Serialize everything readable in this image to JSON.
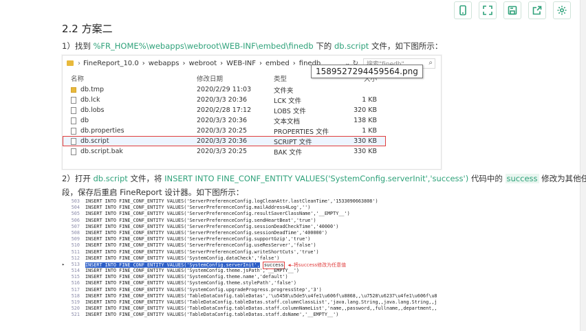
{
  "toolbar": {
    "icons": [
      "phone-icon",
      "expand-icon",
      "save-icon",
      "share-icon",
      "gear-icon"
    ]
  },
  "heading": "2.2 方案二",
  "step1": {
    "prefix": "1）找到",
    "path": "%FR_HOME%\\webapps\\webroot\\WEB-INF\\embed\\finedb",
    "mid": "下的",
    "file": "db.script",
    "suffix": "文件，如下图所示："
  },
  "explorer": {
    "breadcrumb": [
      "FineReport_10.0",
      "webapps",
      "webroot",
      "WEB-INF",
      "embed",
      "finedb"
    ],
    "search_placeholder": "搜索\"finedb\"",
    "tooltip": "1589527294459564.png",
    "columns": {
      "name": "名称",
      "date": "修改日期",
      "type": "类型",
      "size": "大小"
    },
    "rows": [
      {
        "name": "db.tmp",
        "date": "2020/2/29 11:03",
        "type": "文件夹",
        "size": "",
        "icon": "folder"
      },
      {
        "name": "db.lck",
        "date": "2020/3/3 20:36",
        "type": "LCK 文件",
        "size": "1 KB",
        "icon": "file"
      },
      {
        "name": "db.lobs",
        "date": "2020/2/28 17:12",
        "type": "LOBS 文件",
        "size": "320 KB",
        "icon": "file"
      },
      {
        "name": "db",
        "date": "2020/3/3 20:36",
        "type": "文本文档",
        "size": "138 KB",
        "icon": "file"
      },
      {
        "name": "db.properties",
        "date": "2020/3/3 20:25",
        "type": "PROPERTIES 文件",
        "size": "1 KB",
        "icon": "file"
      },
      {
        "name": "db.script",
        "date": "2020/3/3 20:36",
        "type": "SCRIPT 文件",
        "size": "330 KB",
        "icon": "file",
        "selected": true
      },
      {
        "name": "db.script.bak",
        "date": "2020/3/3 20:25",
        "type": "BAK 文件",
        "size": "330 KB",
        "icon": "file"
      }
    ]
  },
  "step2": {
    "prefix": "2）打开",
    "file": "db.script",
    "mid1": "文件，将",
    "code": "INSERT INTO FINE_CONF_ENTITY VALUES('SystemConfig.serverInit','success')",
    "mid2": "代码中的",
    "word": "success",
    "suffix": "修改为其他任意字",
    "line2": "段，保存后重启 FineReport 设计器。如下图所示："
  },
  "code": {
    "lines": [
      {
        "n": "503",
        "t": "INSERT INTO FINE_CONF_ENTITY VALUES('ServerPreferenceConfig.logCleanAttr.lastCleanTime','1533090663808')"
      },
      {
        "n": "504",
        "t": "INSERT INTO FINE_CONF_ENTITY VALUES('ServerPreferenceConfig.mailAddress4Log','')"
      },
      {
        "n": "505",
        "t": "INSERT INTO FINE_CONF_ENTITY VALUES('ServerPreferenceConfig.resultSaverClassName','__EMPTY__')"
      },
      {
        "n": "506",
        "t": "INSERT INTO FINE_CONF_ENTITY VALUES('ServerPreferenceConfig.sendHeartBeat','true')"
      },
      {
        "n": "507",
        "t": "INSERT INTO FINE_CONF_ENTITY VALUES('ServerPreferenceConfig.sessionDeadCheckTime','40000')"
      },
      {
        "n": "508",
        "t": "INSERT INTO FINE_CONF_ENTITY VALUES('ServerPreferenceConfig.sessionDeadTime','400000')"
      },
      {
        "n": "509",
        "t": "INSERT INTO FINE_CONF_ENTITY VALUES('ServerPreferenceConfig.supportGzip','true')"
      },
      {
        "n": "510",
        "t": "INSERT INTO FINE_CONF_ENTITY VALUES('ServerPreferenceConfig.useResServer','false')"
      },
      {
        "n": "511",
        "t": "INSERT INTO FINE_CONF_ENTITY VALUES('ServerPreferenceConfig.writeShortCuts','true')"
      },
      {
        "n": "512",
        "t": "INSERT INTO FINE_CONF_ENTITY VALUES('SystemConfig.dataCheck','false')"
      },
      {
        "n": "513",
        "sel": "INSERT INTO FINE_CONF_ENTITY VALUES('SystemConfig.serverInit',",
        "succ": "success",
        "ann": "将success修改为任意值"
      },
      {
        "n": "514",
        "t": "INSERT INTO FINE_CONF_ENTITY VALUES('SystemConfig.theme.jsPath','__EMPTY__')"
      },
      {
        "n": "515",
        "t": "INSERT INTO FINE_CONF_ENTITY VALUES('SystemConfig.theme.name','default')"
      },
      {
        "n": "516",
        "t": "INSERT INTO FINE_CONF_ENTITY VALUES('SystemConfig.theme.stylePath','false')"
      },
      {
        "n": "517",
        "t": "INSERT INTO FINE_CONF_ENTITY VALUES('SystemConfig.upgradeProgress.progressStep','3')"
      },
      {
        "n": "518",
        "t": "INSERT INTO FINE_CONF_ENTITY VALUES('TableDataConfig.tableDatas','\\u5458\\u5de5\\u4fe1\\u606f\\u8868,,\\u7528\\u6237\\u4fe1\\u606f\\u8"
      },
      {
        "n": "519",
        "t": "INSERT INTO FINE_CONF_ENTITY VALUES('TableDataConfig.tableDatas.staff.columnClassList','java.lang.String,,java.lang.String,,j"
      },
      {
        "n": "520",
        "t": "INSERT INTO FINE_CONF_ENTITY VALUES('TableDataConfig.tableDatas.staff.columnNameList','name,,password,,fullname,,department,,"
      },
      {
        "n": "521",
        "t": "INSERT INTO FINE_CONF_ENTITY VALUES('TableDataConfig.tableDatas.staff.dsName','__EMPTY__')"
      }
    ]
  }
}
